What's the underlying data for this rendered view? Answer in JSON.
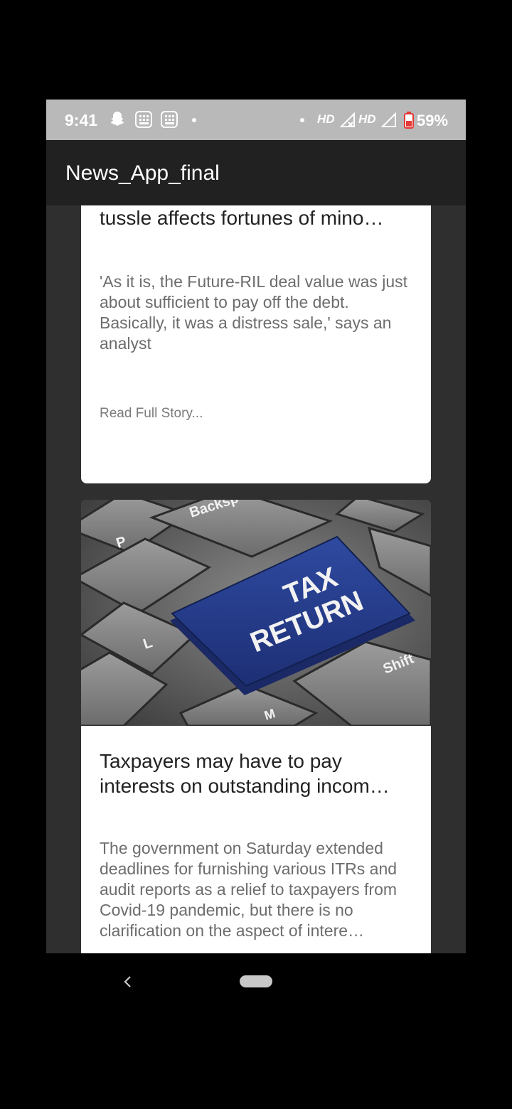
{
  "status_bar": {
    "time": "9:41",
    "hd_1": "HD",
    "hd_2": "HD",
    "battery_pct": "59%"
  },
  "app_bar": {
    "title": "News_App_final"
  },
  "articles": [
    {
      "title": "tussle affects fortunes of mino…",
      "description": "'As it is, the Future-RIL deal value was just about sufficient to pay off the debt. Basically, it was a distress sale,' says an analyst",
      "read_more": "Read Full Story..."
    },
    {
      "image_keys": [
        "Backsp",
        "P",
        "TAX",
        "RETURN",
        "L",
        "Shift",
        "M"
      ],
      "title": "Taxpayers may have to pay interests on outstanding incom…",
      "description": "The government on Saturday extended deadlines for furnishing various ITRs and audit reports as a relief to taxpayers from Covid-19 pandemic, but there is no clarification on the aspect of intere…"
    }
  ],
  "nav": {
    "back_icon": "chevron-left-icon",
    "home_icon": "home-pill-icon"
  }
}
